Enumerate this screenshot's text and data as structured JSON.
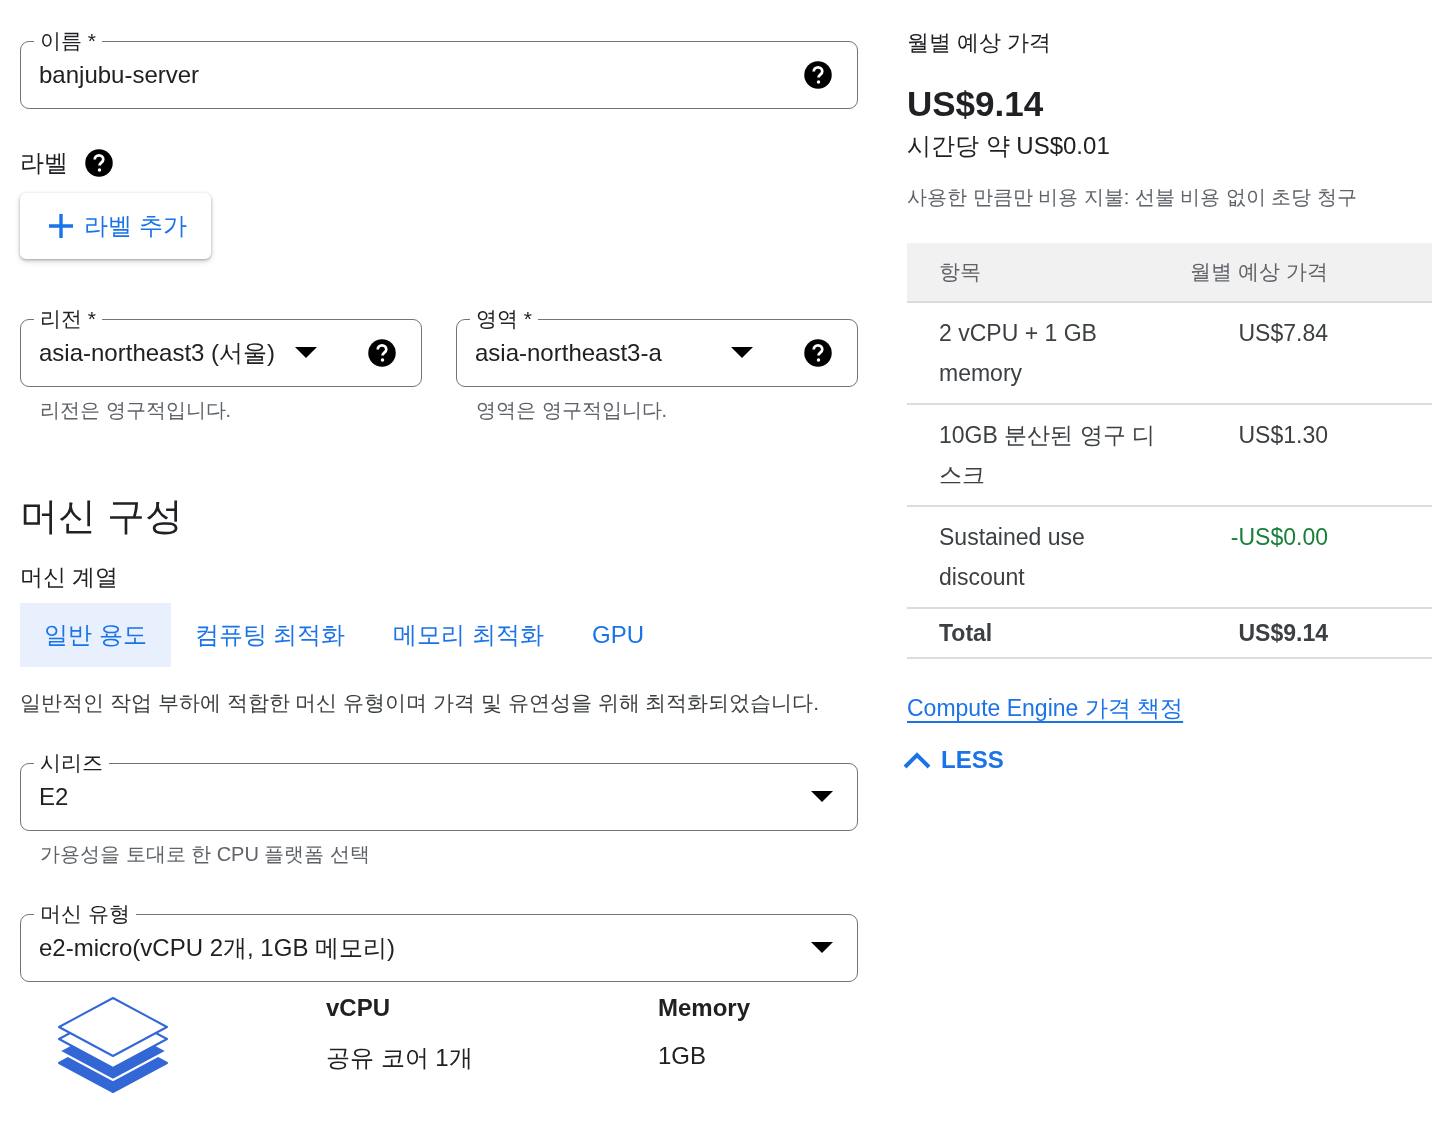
{
  "name_field": {
    "label": "이름 *",
    "value": "banjubu-server",
    "dropdown": false,
    "help": true
  },
  "labels_section": {
    "title": "라벨",
    "add_button": "라벨 추가"
  },
  "location_fields": [
    {
      "label": "리전 *",
      "value": "asia-northeast3 (서울)",
      "dropdown": true,
      "help": true,
      "hint": "리전은 영구적입니다."
    },
    {
      "label": "영역 *",
      "value": "asia-northeast3-a",
      "dropdown": true,
      "help": true,
      "hint": "영역은 영구적입니다."
    }
  ],
  "machine_config": {
    "title": "머신 구성",
    "family_label": "머신 계열",
    "tabs": [
      {
        "label": "일반 용도",
        "selected": true
      },
      {
        "label": "컴퓨팅 최적화",
        "selected": false
      },
      {
        "label": "메모리 최적화",
        "selected": false
      },
      {
        "label": "GPU",
        "selected": false
      }
    ],
    "description": "일반적인 작업 부하에 적합한 머신 유형이며 가격 및 유연성을 위해 최적화되었습니다.",
    "series_field": {
      "label": "시리즈",
      "value": "E2",
      "dropdown": true,
      "help": false,
      "hint": "가용성을 토대로 한 CPU 플랫폼 선택"
    },
    "type_field": {
      "label": "머신 유형",
      "value": "e2-micro(vCPU 2개, 1GB 메모리)",
      "dropdown": true,
      "help": false
    },
    "specs": [
      {
        "heading": "vCPU",
        "value": "공유 코어 1개"
      },
      {
        "heading": "Memory",
        "value": "1GB"
      }
    ]
  },
  "pricing": {
    "title": "월별 예상 가격",
    "monthly_total": "US$9.14",
    "hourly": "시간당 약 US$0.01",
    "note": "사용한 만큼만 비용 지불: 선불 비용 없이 초당 청구",
    "table": {
      "columns": [
        "항목",
        "월별 예상 가격"
      ],
      "rows": [
        {
          "kind": "cost",
          "item": "2 vCPU + 1 GB memory",
          "price": "US$7.84"
        },
        {
          "kind": "cost",
          "item": "10GB 분산된 영구 디스크",
          "price": "US$1.30"
        },
        {
          "kind": "discount",
          "item": "Sustained use discount",
          "price": "-US$0.00"
        },
        {
          "kind": "total",
          "item": "Total",
          "price": "US$9.14"
        }
      ]
    },
    "link": "Compute Engine 가격 책정",
    "toggle_button": "LESS"
  }
}
